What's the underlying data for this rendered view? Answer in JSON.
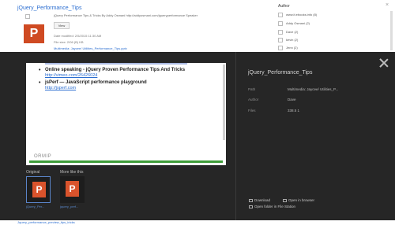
{
  "background": {
    "result": {
      "title": "jQuery_Performance_Tips",
      "snippet": "jQuery Performance Tips & Tricks By Addy Osmani http://addyosmani.com/jqueryperformance Speaker",
      "file_letter": "P",
      "view_label": "View",
      "meta_lines": [
        "Date modified: 2/5/2015 11:30 AM",
        "File size: 2/06 (B) KB",
        "Multimedia: Jaycee/ Utilities_Performance_Tips.pptx"
      ]
    },
    "facet": {
      "header": "Author",
      "close_label": "×",
      "items": [
        "www.it.ebooks.info (8)",
        "Addy Osmani (2)",
        "Dave (2)",
        "kevin (2)",
        "Jenn (2)",
        "gene a. o. h. (2)"
      ]
    },
    "bottom_link": "Jquery_performance_preview_tips_tricks"
  },
  "preview": {
    "items": [
      {
        "text": "",
        "link": ""
      },
      {
        "text": "Online speaking - jQuery Proven Performance Tips And Tricks",
        "link": "http://vimeo.com/26426024"
      },
      {
        "text": "jsPerf — JavaScript performance playground",
        "link": "http://jsperf.com"
      }
    ],
    "brand": "ORMIP"
  },
  "thumbnails": {
    "original_label": "Original",
    "more_label": "More like this",
    "items": [
      {
        "letter": "P",
        "name": "jQuery_Per..."
      },
      {
        "letter": "P",
        "name": "jquery_perf..."
      }
    ]
  },
  "details": {
    "title": "jQuery_Performance_Tips",
    "fields": [
      {
        "label": "Path",
        "value": "Multimedia: Jaycee/ Utilities_P..."
      },
      {
        "label": "Author",
        "value": "Dave"
      },
      {
        "label": "Files",
        "value": "338.5 1"
      }
    ],
    "actions": {
      "download": "Download",
      "open_browser": "Open in browser",
      "open_folder": "Open folder in File Station"
    }
  },
  "colors": {
    "overlay": "#262626",
    "accent": "#2a6dd0",
    "file_icon": "#cf4a22"
  }
}
